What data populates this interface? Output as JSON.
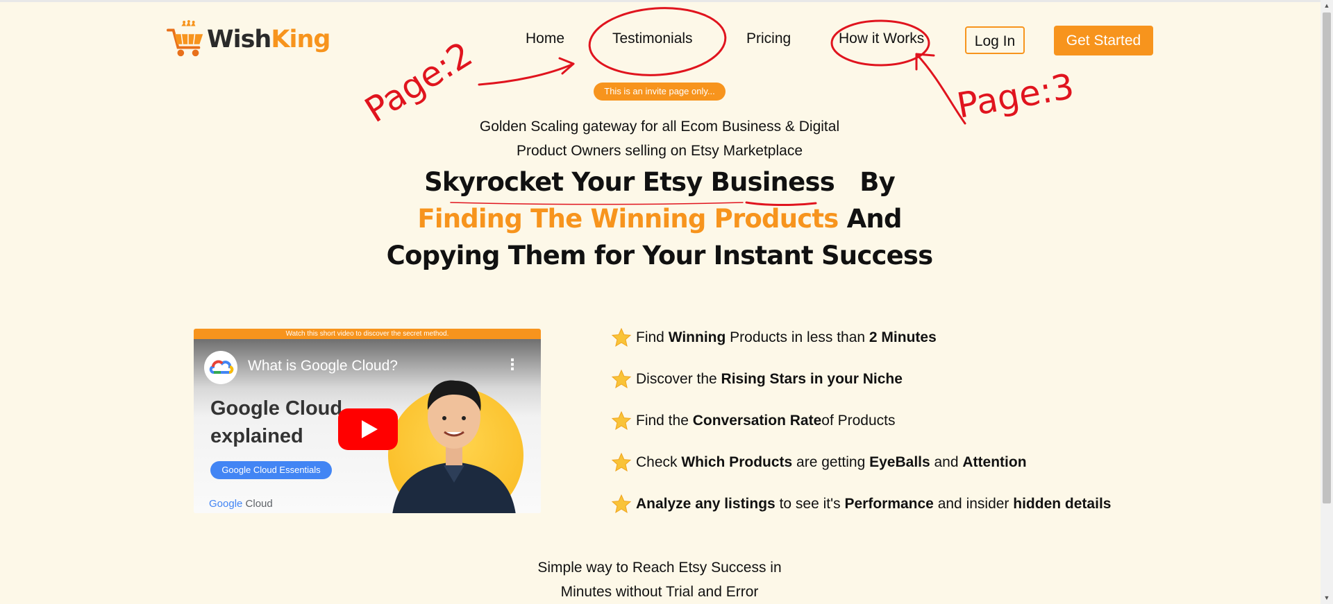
{
  "brand": {
    "part1": "Wish",
    "part2": "King"
  },
  "nav": {
    "home": "Home",
    "testimonials": "Testimonials",
    "pricing": "Pricing",
    "how_it_works": "How it Works",
    "login": "Log In",
    "get_started": "Get Started"
  },
  "invite_badge": "This is an invite page only...",
  "subheading": {
    "line1": "Golden Scaling gateway for all Ecom Business & Digital",
    "line2": "Product Owners selling on Etsy Marketplace"
  },
  "headline": {
    "line1": "Skyrocket Your Etsy Business",
    "line1_end": "By",
    "line2_orange": "Finding The Winning Products",
    "line2_end": "And",
    "line3": "Copying Them for Your Instant Success"
  },
  "video": {
    "banner": "Watch this short video to discover the secret method.",
    "title": "What is Google Cloud?",
    "big_text": "Google Cloud explained",
    "chip": "Google Cloud Essentials",
    "brand_google": "Google",
    "brand_cloud": "Cloud"
  },
  "features": [
    {
      "parts": [
        [
          "Find ",
          false
        ],
        [
          "Winning",
          true
        ],
        [
          " Products in less than ",
          false
        ],
        [
          "2 Minutes",
          true
        ]
      ]
    },
    {
      "parts": [
        [
          "Discover the ",
          false
        ],
        [
          "Rising Stars in your Niche",
          true
        ]
      ]
    },
    {
      "parts": [
        [
          "Find the ",
          false
        ],
        [
          "Conversation Rate",
          true
        ],
        [
          "of Products",
          false
        ]
      ]
    },
    {
      "parts": [
        [
          "Check ",
          false
        ],
        [
          "Which Products",
          true
        ],
        [
          " are getting ",
          false
        ],
        [
          "EyeBalls",
          true
        ],
        [
          " and ",
          false
        ],
        [
          "Attention",
          true
        ]
      ]
    },
    {
      "parts": [
        [
          "Analyze any listings",
          true
        ],
        [
          " to see it's ",
          false
        ],
        [
          "Performance",
          true
        ],
        [
          " and insider ",
          false
        ],
        [
          "hidden details",
          true
        ]
      ]
    }
  ],
  "bottom": {
    "line1": "Simple way to Reach Etsy Success in",
    "line2": "Minutes without Trial and Error"
  },
  "annotations": {
    "left": "Page:2",
    "right": "Page:3"
  },
  "colors": {
    "accent": "#f7941d",
    "background": "#fdf8e8",
    "annotation": "#e0141e"
  }
}
